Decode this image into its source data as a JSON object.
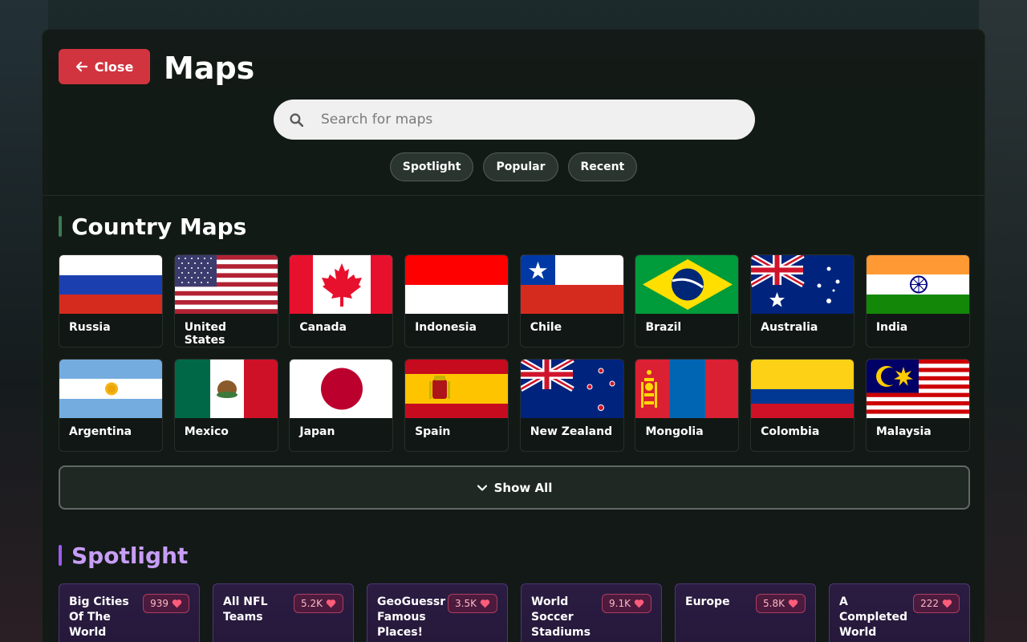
{
  "header": {
    "close_label": "Close",
    "title": "Maps",
    "search_placeholder": "Search for maps",
    "filters": [
      "Spotlight",
      "Popular",
      "Recent"
    ]
  },
  "country_section": {
    "title": "Country Maps",
    "countries": [
      "Russia",
      "United States",
      "Canada",
      "Indonesia",
      "Chile",
      "Brazil",
      "Australia",
      "India",
      "Argentina",
      "Mexico",
      "Japan",
      "Spain",
      "New Zealand",
      "Mongolia",
      "Colombia",
      "Malaysia"
    ],
    "show_all_label": "Show All"
  },
  "spotlight_section": {
    "title": "Spotlight",
    "maps": [
      {
        "name": "Big Cities Of The World",
        "likes": "939"
      },
      {
        "name": "All NFL Teams",
        "likes": "5.2K"
      },
      {
        "name": "GeoGuessr Famous Places!",
        "likes": "3.5K"
      },
      {
        "name": "World Soccer Stadiums",
        "likes": "9.1K"
      },
      {
        "name": "Europe",
        "likes": "5.8K"
      },
      {
        "name": "A Completed World",
        "likes": "222"
      }
    ]
  },
  "colors": {
    "close_button": "#d2343f",
    "spotlight_accent": "#9a5cf0",
    "country_accent": "#3e7a52"
  }
}
